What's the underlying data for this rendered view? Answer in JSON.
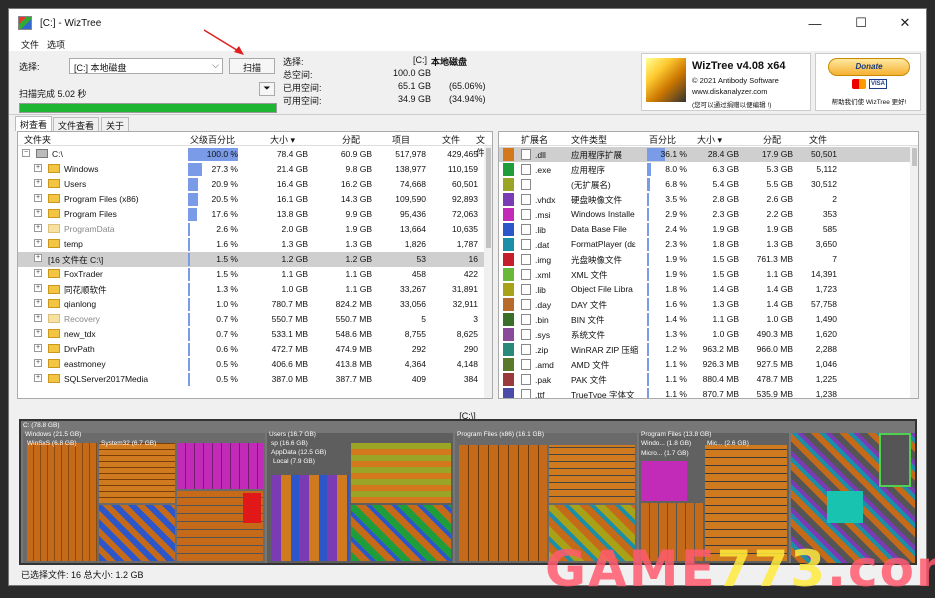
{
  "window": {
    "title": "[C:]  - WizTree"
  },
  "menu": [
    "文件",
    "选项"
  ],
  "toolbar": {
    "select_label": "选择:",
    "drive_value": "[C:] 本地磁盘",
    "scan_label": "扫描",
    "scan_done": "扫描完成 5.02 秒",
    "scan_progress": 1.0
  },
  "summary": {
    "select_k": "选择:",
    "select_v": "[C:]",
    "select_name": "本地磁盘",
    "total_k": "总空间:",
    "total_v": "100.0 GB",
    "used_k": "已用空间:",
    "used_v": "65.1 GB",
    "used_p": "(65.06%)",
    "free_k": "可用空间:",
    "free_v": "34.9 GB",
    "free_p": "(34.94%)"
  },
  "brand": {
    "name": "WizTree v4.08 x64",
    "copyright": "© 2021 Antibody Software",
    "site": "www.diskanalyzer.com",
    "note": "(您可以通过捐赠以便编辑 !)"
  },
  "donate": {
    "label": "Donate",
    "help": "帮助我们使 WizTree 更好!"
  },
  "tabs": [
    "树查看",
    "文件查看",
    "关于"
  ],
  "tree": {
    "headers": {
      "folder": "文件夹",
      "pct": "父级百分比",
      "size": "大小 ▾",
      "alloc": "分配",
      "items": "项目",
      "files": "文件",
      "more": "文件"
    },
    "rows": [
      {
        "name": "C:\\",
        "pct": "100.0 %",
        "pctv": 1.0,
        "size": "78.4 GB",
        "alloc": "60.9 GB",
        "items": "517,978",
        "files": "429,465",
        "level": 0,
        "exp": "−",
        "kind": "drive"
      },
      {
        "name": "Windows",
        "pct": "27.3 %",
        "pctv": 0.273,
        "size": "21.4 GB",
        "alloc": "9.8 GB",
        "items": "138,977",
        "files": "110,159",
        "level": 1,
        "exp": "+",
        "kind": "folder"
      },
      {
        "name": "Users",
        "pct": "20.9 %",
        "pctv": 0.209,
        "size": "16.4 GB",
        "alloc": "16.2 GB",
        "items": "74,668",
        "files": "60,501",
        "level": 1,
        "exp": "+",
        "kind": "folder"
      },
      {
        "name": "Program Files (x86)",
        "pct": "20.5 %",
        "pctv": 0.205,
        "size": "16.1 GB",
        "alloc": "14.3 GB",
        "items": "109,590",
        "files": "92,893",
        "level": 1,
        "exp": "+",
        "kind": "folder"
      },
      {
        "name": "Program Files",
        "pct": "17.6 %",
        "pctv": 0.176,
        "size": "13.8 GB",
        "alloc": "9.9 GB",
        "items": "95,436",
        "files": "72,063",
        "level": 1,
        "exp": "+",
        "kind": "folder"
      },
      {
        "name": "ProgramData",
        "pct": "2.6 %",
        "pctv": 0.026,
        "size": "2.0 GB",
        "alloc": "1.9 GB",
        "items": "13,664",
        "files": "10,635",
        "level": 1,
        "exp": "+",
        "kind": "dim"
      },
      {
        "name": "temp",
        "pct": "1.6 %",
        "pctv": 0.016,
        "size": "1.3 GB",
        "alloc": "1.3 GB",
        "items": "1,826",
        "files": "1,787",
        "level": 1,
        "exp": "+",
        "kind": "folder"
      },
      {
        "name": "[16 文件在 C:\\]",
        "pct": "1.5 %",
        "pctv": 0.015,
        "size": "1.2 GB",
        "alloc": "1.2 GB",
        "items": "53",
        "files": "16",
        "level": 1,
        "exp": "+",
        "kind": "none",
        "sel": true
      },
      {
        "name": "FoxTrader",
        "pct": "1.5 %",
        "pctv": 0.015,
        "size": "1.1 GB",
        "alloc": "1.1 GB",
        "items": "458",
        "files": "422",
        "level": 1,
        "exp": "+",
        "kind": "folder"
      },
      {
        "name": "同花顺软件",
        "pct": "1.3 %",
        "pctv": 0.013,
        "size": "1.0 GB",
        "alloc": "1.1 GB",
        "items": "33,267",
        "files": "31,891",
        "level": 1,
        "exp": "+",
        "kind": "folder"
      },
      {
        "name": "qianlong",
        "pct": "1.0 %",
        "pctv": 0.01,
        "size": "780.7 MB",
        "alloc": "824.2 MB",
        "items": "33,056",
        "files": "32,911",
        "level": 1,
        "exp": "+",
        "kind": "folder"
      },
      {
        "name": "Recovery",
        "pct": "0.7 %",
        "pctv": 0.007,
        "size": "550.7 MB",
        "alloc": "550.7 MB",
        "items": "5",
        "files": "3",
        "level": 1,
        "exp": "+",
        "kind": "dim"
      },
      {
        "name": "new_tdx",
        "pct": "0.7 %",
        "pctv": 0.007,
        "size": "533.1 MB",
        "alloc": "548.6 MB",
        "items": "8,755",
        "files": "8,625",
        "level": 1,
        "exp": "+",
        "kind": "folder"
      },
      {
        "name": "DrvPath",
        "pct": "0.6 %",
        "pctv": 0.006,
        "size": "472.7 MB",
        "alloc": "474.9 MB",
        "items": "292",
        "files": "290",
        "level": 1,
        "exp": "+",
        "kind": "folder"
      },
      {
        "name": "eastmoney",
        "pct": "0.5 %",
        "pctv": 0.005,
        "size": "406.6 MB",
        "alloc": "413.8 MB",
        "items": "4,364",
        "files": "4,148",
        "level": 1,
        "exp": "+",
        "kind": "folder"
      },
      {
        "name": "SQLServer2017Media",
        "pct": "0.5 %",
        "pctv": 0.005,
        "size": "387.0 MB",
        "alloc": "387.7 MB",
        "items": "409",
        "files": "384",
        "level": 1,
        "exp": "+",
        "kind": "folder"
      }
    ]
  },
  "ext": {
    "headers": {
      "ext": "扩展名",
      "type": "文件类型",
      "pct": "百分比",
      "size": "大小 ▾",
      "alloc": "分配",
      "files": "文件"
    },
    "rows": [
      {
        "color": "#d4781e",
        "ext": ".dll",
        "type": "应用程序扩展",
        "pct": "36.1 %",
        "pctv": 0.361,
        "size": "28.4 GB",
        "alloc": "17.9 GB",
        "files": "50,501",
        "sel": true
      },
      {
        "color": "#1f9d3a",
        "ext": ".exe",
        "type": "应用程序",
        "pct": "8.0 %",
        "pctv": 0.08,
        "size": "6.3 GB",
        "alloc": "5.3 GB",
        "files": "5,112"
      },
      {
        "color": "#9aa526",
        "ext": "",
        "type": "(无扩展名)",
        "pct": "6.8 %",
        "pctv": 0.068,
        "size": "5.4 GB",
        "alloc": "5.5 GB",
        "files": "30,512"
      },
      {
        "color": "#7a3bb5",
        "ext": ".vhdx",
        "type": "硬盘映像文件",
        "pct": "3.5 %",
        "pctv": 0.035,
        "size": "2.8 GB",
        "alloc": "2.6 GB",
        "files": "2"
      },
      {
        "color": "#c22ab8",
        "ext": ".msi",
        "type": "Windows Installe",
        "pct": "2.9 %",
        "pctv": 0.029,
        "size": "2.3 GB",
        "alloc": "2.2 GB",
        "files": "353"
      },
      {
        "color": "#2d57c9",
        "ext": ".lib",
        "type": "Data Base File",
        "pct": "2.4 %",
        "pctv": 0.024,
        "size": "1.9 GB",
        "alloc": "1.9 GB",
        "files": "585"
      },
      {
        "color": "#1b8fa8",
        "ext": ".dat",
        "type": "FormatPlayer (dε",
        "pct": "2.3 %",
        "pctv": 0.023,
        "size": "1.8 GB",
        "alloc": "1.3 GB",
        "files": "3,650"
      },
      {
        "color": "#c41f2a",
        "ext": ".img",
        "type": "光盘映像文件",
        "pct": "1.9 %",
        "pctv": 0.019,
        "size": "1.5 GB",
        "alloc": "761.3 MB",
        "files": "7"
      },
      {
        "color": "#6ab83a",
        "ext": ".xml",
        "type": "XML 文件",
        "pct": "1.9 %",
        "pctv": 0.019,
        "size": "1.5 GB",
        "alloc": "1.1 GB",
        "files": "14,391"
      },
      {
        "color": "#a8a218",
        "ext": ".lib",
        "type": "Object File Libra",
        "pct": "1.8 %",
        "pctv": 0.018,
        "size": "1.4 GB",
        "alloc": "1.4 GB",
        "files": "1,723"
      },
      {
        "color": "#b86a2a",
        "ext": ".day",
        "type": "DAY 文件",
        "pct": "1.6 %",
        "pctv": 0.016,
        "size": "1.3 GB",
        "alloc": "1.4 GB",
        "files": "57,758"
      },
      {
        "color": "#3a6f2a",
        "ext": ".bin",
        "type": "BIN 文件",
        "pct": "1.4 %",
        "pctv": 0.014,
        "size": "1.1 GB",
        "alloc": "1.0 GB",
        "files": "1,490"
      },
      {
        "color": "#8a4a9a",
        "ext": ".sys",
        "type": "系统文件",
        "pct": "1.3 %",
        "pctv": 0.013,
        "size": "1.0 GB",
        "alloc": "490.3 MB",
        "files": "1,620"
      },
      {
        "color": "#2a8a7a",
        "ext": ".zip",
        "type": "WinRAR ZIP 压缩",
        "pct": "1.2 %",
        "pctv": 0.012,
        "size": "963.2 MB",
        "alloc": "966.0 MB",
        "files": "2,288"
      },
      {
        "color": "#5a7a2a",
        "ext": ".amd",
        "type": "AMD 文件",
        "pct": "1.1 %",
        "pctv": 0.011,
        "size": "926.3 MB",
        "alloc": "927.5 MB",
        "files": "1,046"
      },
      {
        "color": "#9a3a3a",
        "ext": ".pak",
        "type": "PAK 文件",
        "pct": "1.1 %",
        "pctv": 0.011,
        "size": "880.4 MB",
        "alloc": "478.7 MB",
        "files": "1,225"
      },
      {
        "color": "#4a4aa8",
        "ext": ".ttf",
        "type": "TrueType 字体文",
        "pct": "1.1 %",
        "pctv": 0.011,
        "size": "870.7 MB",
        "alloc": "535.9 MB",
        "files": "1,238"
      }
    ]
  },
  "treemap": {
    "title": "[C:\\]",
    "labels": {
      "root": "C: (78.8 GB)",
      "windows": "Windows (21.5 GB)",
      "winsxs": "WinSxS (6.8 GB)",
      "system32": "System32 (6.7 GB)",
      "users": "Users (16.7 GB)",
      "sp": "sp (16.6 GB)",
      "appdata": "AppData (12.5 GB)",
      "local": "Local (7.9 GB)",
      "pfx86": "Program Files (x86) (16.1 GB)",
      "pf": "Program Files (13.8 GB)",
      "pfwin": "Windo... (1.8 GB)",
      "pfmic": "Mic... (2.6 GB)",
      "pfmicro": "Micro... (1.7 GB)"
    }
  },
  "status": "已选择文件: 16  总大小: 1.2 GB",
  "watermark": {
    "a": "GAME",
    "b": "773",
    "c": ".com"
  }
}
